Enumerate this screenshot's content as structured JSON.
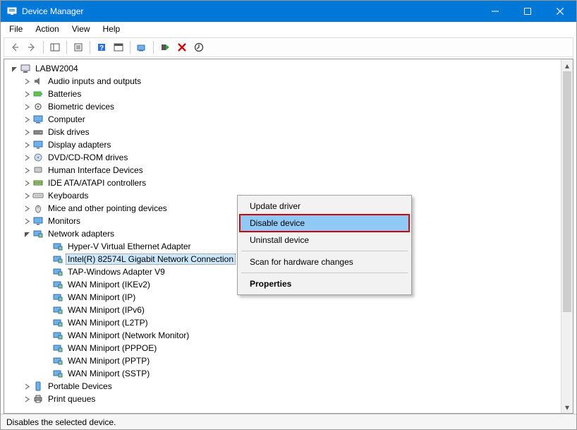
{
  "window": {
    "title": "Device Manager"
  },
  "menubar": {
    "items": [
      "File",
      "Action",
      "View",
      "Help"
    ]
  },
  "tree": {
    "root": "LABW2004",
    "categories": [
      {
        "label": "Audio inputs and outputs",
        "icon": "audio"
      },
      {
        "label": "Batteries",
        "icon": "battery"
      },
      {
        "label": "Biometric devices",
        "icon": "biometric"
      },
      {
        "label": "Computer",
        "icon": "computer"
      },
      {
        "label": "Disk drives",
        "icon": "disk"
      },
      {
        "label": "Display adapters",
        "icon": "display"
      },
      {
        "label": "DVD/CD-ROM drives",
        "icon": "dvd"
      },
      {
        "label": "Human Interface Devices",
        "icon": "hid"
      },
      {
        "label": "IDE ATA/ATAPI controllers",
        "icon": "ide"
      },
      {
        "label": "Keyboards",
        "icon": "keyboard"
      },
      {
        "label": "Mice and other pointing devices",
        "icon": "mouse"
      },
      {
        "label": "Monitors",
        "icon": "monitor"
      }
    ],
    "network": {
      "label": "Network adapters",
      "children": [
        "Hyper-V Virtual Ethernet Adapter",
        "Intel(R) 82574L Gigabit Network Connection",
        "TAP-Windows Adapter V9",
        "WAN Miniport (IKEv2)",
        "WAN Miniport (IP)",
        "WAN Miniport (IPv6)",
        "WAN Miniport (L2TP)",
        "WAN Miniport (Network Monitor)",
        "WAN Miniport (PPPOE)",
        "WAN Miniport (PPTP)",
        "WAN Miniport (SSTP)"
      ],
      "selected_index": 1
    },
    "after": [
      {
        "label": "Portable Devices",
        "icon": "portable"
      },
      {
        "label": "Print queues",
        "icon": "printer"
      }
    ]
  },
  "context_menu": {
    "items": [
      "Update driver",
      "Disable device",
      "Uninstall device",
      "Scan for hardware changes",
      "Properties"
    ],
    "highlighted_index": 1,
    "bold_index": 4
  },
  "statusbar": {
    "text": "Disables the selected device."
  }
}
